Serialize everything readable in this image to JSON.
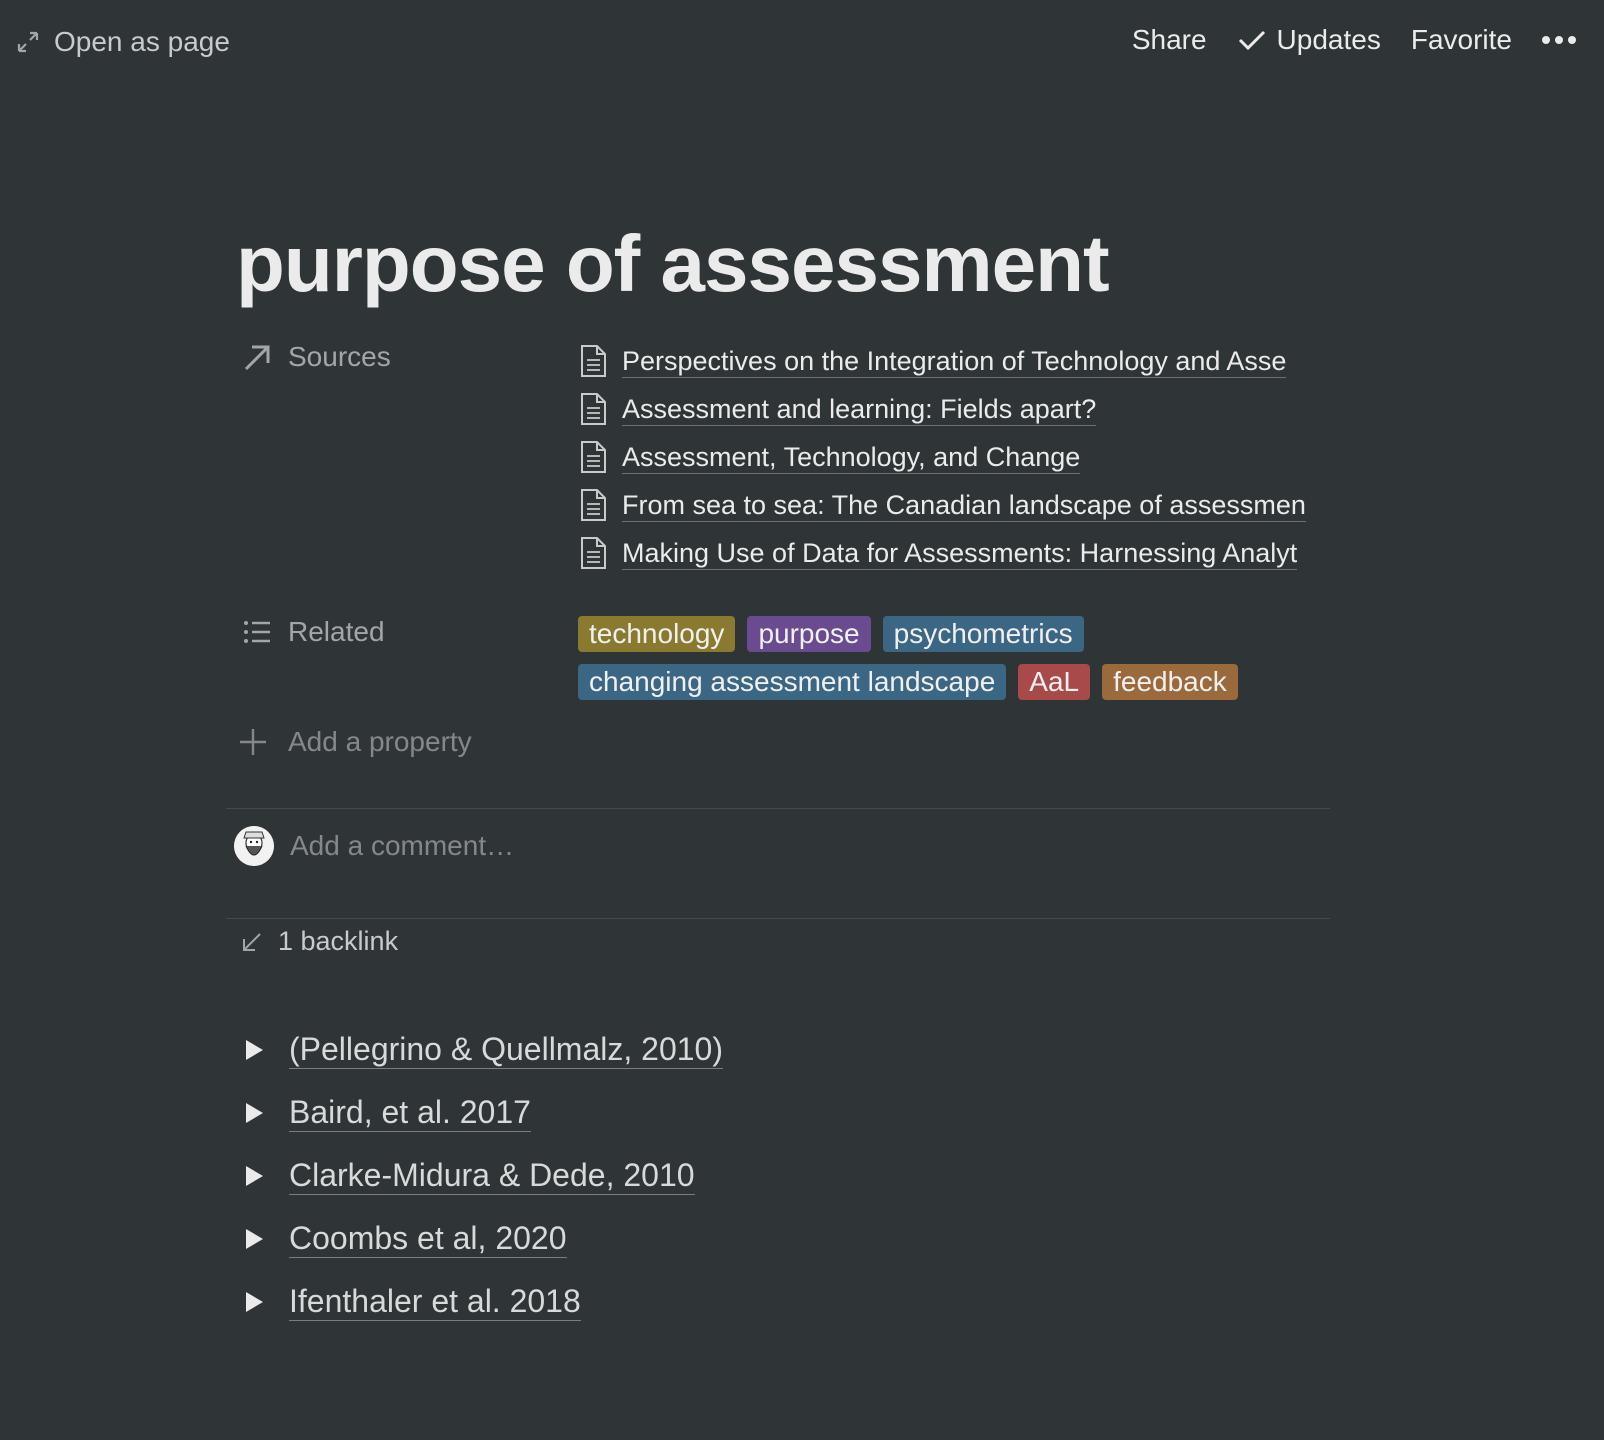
{
  "topbar": {
    "open_as_page": "Open as page",
    "share": "Share",
    "updates": "Updates",
    "favorite": "Favorite",
    "more_icon": "ellipsis-icon"
  },
  "page": {
    "title": "purpose of assessment"
  },
  "properties": {
    "sources": {
      "label": "Sources",
      "icon": "arrow-up-right-icon",
      "items": [
        "Perspectives on the Integration of Technology and Asse",
        "Assessment and learning: Fields apart?",
        "Assessment, Technology, and Change",
        "From sea to sea: The Canadian landscape of assessmen",
        "Making Use of Data for Assessments: Harnessing Analyt"
      ]
    },
    "related": {
      "label": "Related",
      "icon": "list-icon",
      "tags": [
        {
          "label": "technology",
          "color": "#8a7a30"
        },
        {
          "label": "purpose",
          "color": "#6a4b8f"
        },
        {
          "label": "psychometrics",
          "color": "#3b6785"
        },
        {
          "label": "changing assessment landscape",
          "color": "#3b6785"
        },
        {
          "label": "AaL",
          "color": "#a84a4a"
        },
        {
          "label": "feedback",
          "color": "#9a6a3c"
        }
      ]
    },
    "add_property": "Add a property"
  },
  "comment": {
    "placeholder": "Add a comment…"
  },
  "backlinks": {
    "label": "1 backlink"
  },
  "toggles": [
    "(Pellegrino & Quellmalz, 2010)",
    "Baird, et al. 2017",
    "Clarke-Midura & Dede, 2010",
    "Coombs et al, 2020",
    "Ifenthaler et al. 2018"
  ]
}
